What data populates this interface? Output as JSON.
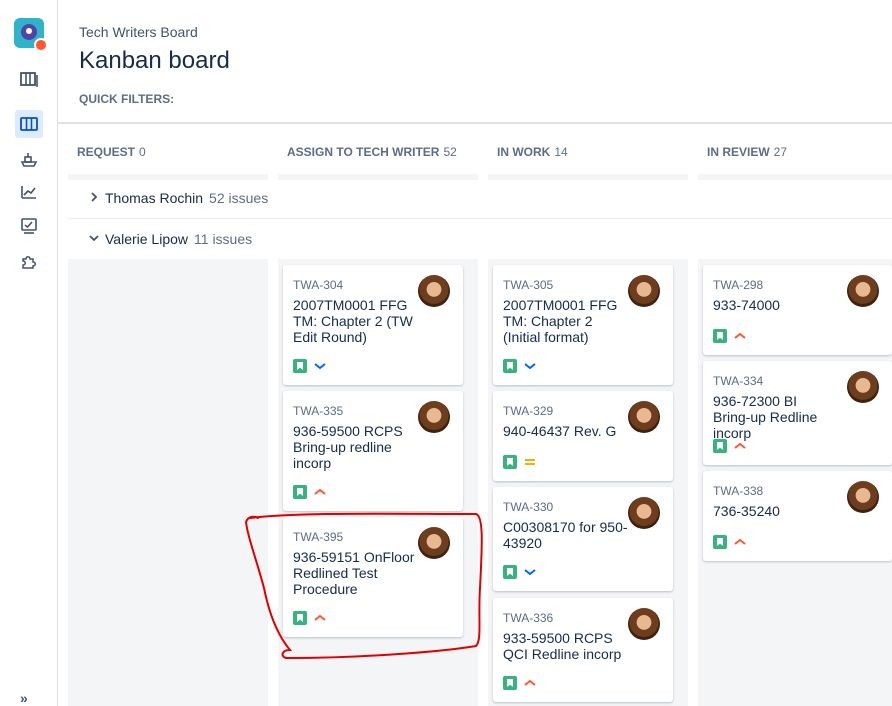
{
  "header": {
    "board_name": "Tech Writers Board",
    "title": "Kanban board",
    "quick_filters_label": "QUICK FILTERS:"
  },
  "sidebar": {
    "items": [
      {
        "name": "backlog-icon"
      },
      {
        "name": "board-icon",
        "active": true
      },
      {
        "name": "releases-icon"
      },
      {
        "name": "reports-icon"
      },
      {
        "name": "issues-icon"
      },
      {
        "name": "add-ons-icon"
      }
    ],
    "expand_label": "»"
  },
  "columns": [
    {
      "title": "REQUEST",
      "count": "0"
    },
    {
      "title": "ASSIGN TO TECH WRITER",
      "count": "52"
    },
    {
      "title": "IN WORK",
      "count": "14"
    },
    {
      "title": "IN REVIEW",
      "count": "27"
    }
  ],
  "swimlanes": [
    {
      "name": "Thomas Rochin",
      "issues": "52 issues",
      "expanded": false
    },
    {
      "name": "Valerie Lipow",
      "issues": "11 issues",
      "expanded": true
    }
  ],
  "cards": {
    "assign": [
      {
        "key": "TWA-304",
        "summary": "2007TM0001 FFG TM: Chapter 2 (TW Edit Round)",
        "priority": "low"
      },
      {
        "key": "TWA-335",
        "summary": "936-59500 RCPS Bring-up redline incorp",
        "priority": "high"
      },
      {
        "key": "TWA-395",
        "summary": "936-59151 OnFloor Redlined Test Procedure",
        "priority": "high"
      }
    ],
    "in_work": [
      {
        "key": "TWA-305",
        "summary": "2007TM0001 FFG TM: Chapter 2 (Initial format)",
        "priority": "low"
      },
      {
        "key": "TWA-329",
        "summary": "940-46437 Rev. G",
        "priority": "medium"
      },
      {
        "key": "TWA-330",
        "summary": "C00308170 for 950-43920",
        "priority": "low"
      },
      {
        "key": "TWA-336",
        "summary": "933-59500 RCPS QCI Redline incorp",
        "priority": "high"
      }
    ],
    "in_review": [
      {
        "key": "TWA-298",
        "summary": "933-74000",
        "priority": "high"
      },
      {
        "key": "TWA-334",
        "summary": "936-72300 BI Bring-up Redline incorp",
        "priority": "high"
      },
      {
        "key": "TWA-338",
        "summary": "736-35240",
        "priority": "high"
      }
    ]
  },
  "colors": {
    "story": "#36b37e",
    "priority_high": "#ff5630",
    "priority_low": "#0065ff",
    "priority_medium": "#ffab00",
    "highlight": "#e00000"
  }
}
